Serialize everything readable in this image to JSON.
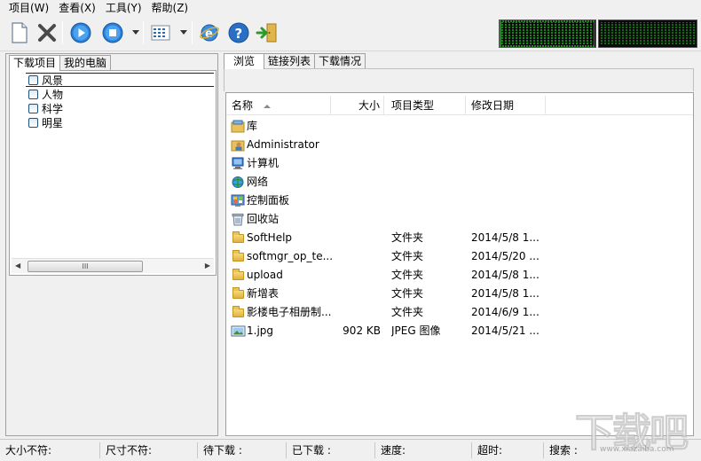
{
  "menubar": [
    "项目(W)",
    "查看(X)",
    "工具(Y)",
    "帮助(Z)"
  ],
  "toolbar": {
    "buttons": [
      "new-icon",
      "delete-icon",
      "start-icon",
      "stop-icon",
      "view-mode-icon",
      "browser-icon",
      "help-icon",
      "exit-icon"
    ]
  },
  "left_tabs": [
    "下载项目",
    "我的电脑"
  ],
  "tree": [
    "风景",
    "人物",
    "科学",
    "明星"
  ],
  "hscroll_grip": "III",
  "right_tabs": [
    "浏览",
    "链接列表",
    "下载情况"
  ],
  "columns": {
    "name": "名称",
    "size": "大小",
    "type": "项目类型",
    "date": "修改日期"
  },
  "files": [
    {
      "icon": "library-icon",
      "name": "库",
      "size": "",
      "type": "",
      "date": ""
    },
    {
      "icon": "user-folder-icon",
      "name": "Administrator",
      "size": "",
      "type": "",
      "date": ""
    },
    {
      "icon": "computer-icon",
      "name": "计算机",
      "size": "",
      "type": "",
      "date": ""
    },
    {
      "icon": "network-icon",
      "name": "网络",
      "size": "",
      "type": "",
      "date": ""
    },
    {
      "icon": "control-panel-icon",
      "name": "控制面板",
      "size": "",
      "type": "",
      "date": ""
    },
    {
      "icon": "recycle-bin-icon",
      "name": "回收站",
      "size": "",
      "type": "",
      "date": ""
    },
    {
      "icon": "folder-icon",
      "name": "SoftHelp",
      "size": "",
      "type": "文件夹",
      "date": "2014/5/8 1..."
    },
    {
      "icon": "folder-icon",
      "name": "softmgr_op_te...",
      "size": "",
      "type": "文件夹",
      "date": "2014/5/20 ..."
    },
    {
      "icon": "folder-icon",
      "name": "upload",
      "size": "",
      "type": "文件夹",
      "date": "2014/5/8 1..."
    },
    {
      "icon": "folder-icon",
      "name": "新增表",
      "size": "",
      "type": "文件夹",
      "date": "2014/5/8 1..."
    },
    {
      "icon": "folder-icon",
      "name": "影楼电子相册制...",
      "size": "",
      "type": "文件夹",
      "date": "2014/6/9 1..."
    },
    {
      "icon": "image-file-icon",
      "name": "1.jpg",
      "size": "902 KB",
      "type": "JPEG 图像",
      "date": "2014/5/21 ..."
    }
  ],
  "status": [
    "大小不符:",
    "尺寸不符:",
    "待下载 :",
    "已下载 :",
    "速度:",
    "超时:",
    "搜索 :"
  ],
  "watermark": {
    "text": "下载吧",
    "url": "www.xiazaiba.com"
  }
}
